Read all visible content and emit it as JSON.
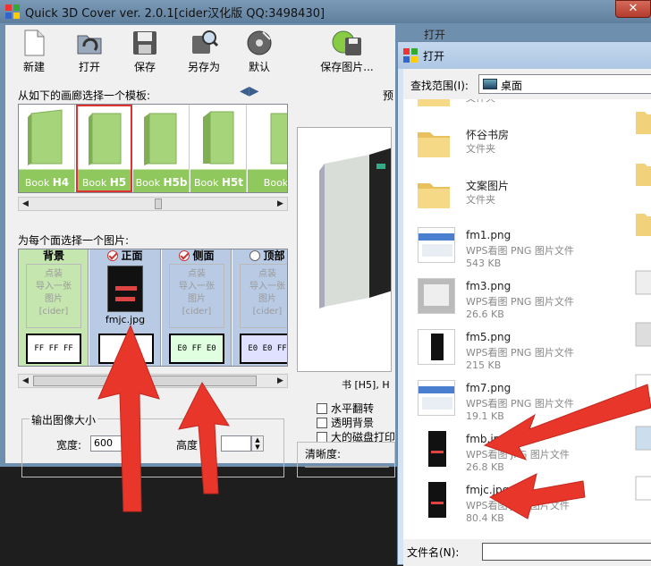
{
  "app": {
    "title": "Quick 3D Cover ver. 2.0.1[cider汉化版 QQ:3498430]",
    "close_icon": "close-icon",
    "toolbar": [
      {
        "label": "新建",
        "icon": "new-file-icon"
      },
      {
        "label": "打开",
        "icon": "open-folder-icon"
      },
      {
        "label": "保存",
        "icon": "floppy-save-icon"
      },
      {
        "label": "另存为",
        "icon": "save-as-icon"
      },
      {
        "label": "默认",
        "icon": "default-disc-icon"
      },
      {
        "label": "保存图片...",
        "icon": "save-image-icon"
      }
    ],
    "template_section_label": "从如下的画廊选择一个模板:",
    "templates": [
      {
        "prefix": "Book ",
        "code": "H4"
      },
      {
        "prefix": "Book ",
        "code": "H5"
      },
      {
        "prefix": "Book ",
        "code": "H5b"
      },
      {
        "prefix": "Book ",
        "code": "H5t"
      },
      {
        "prefix": "Book",
        "code": ""
      }
    ],
    "face_section_label": "为每个面选择一个图片:",
    "faces": [
      {
        "name": "背景",
        "placeholder": [
          "点装",
          "导入一张",
          "图片",
          "[cider]"
        ],
        "color": "FF FF FF",
        "bg": "#c6e6b0"
      },
      {
        "name": "正面",
        "file": "fmjc.jpg",
        "color": "",
        "bg": "#b9cbe4"
      },
      {
        "name": "侧面",
        "placeholder": [
          "点装",
          "导入一张",
          "图片",
          "[cider]"
        ],
        "color": "E0 FF E0",
        "bg": "#b9cbe4"
      },
      {
        "name": "顶部",
        "placeholder": [
          "点装",
          "导入一张",
          "图片",
          "[cider]"
        ],
        "color": "E0 E0 FF",
        "bg": "#b9cbe4"
      }
    ],
    "output_group": "输出图像大小",
    "width_label": "宽度:",
    "width_value": "600",
    "height_label": "高度",
    "preview_label": "预",
    "preview_caption": "书 [H5], H",
    "options": [
      "水平翻转",
      "透明背景",
      "大的磁盘打印"
    ],
    "clarity_label": "清晰度:"
  },
  "background_window": {
    "toolbar_label": "打开"
  },
  "dialog": {
    "title": "打开",
    "look_in_label": "查找范围(I):",
    "look_in_value": "桌面",
    "items": [
      {
        "name": "",
        "type": "文件夹",
        "size": "",
        "kind": "folder"
      },
      {
        "name": "怀谷书房",
        "type": "文件夹",
        "size": "",
        "kind": "folder"
      },
      {
        "name": "文案图片",
        "type": "文件夹",
        "size": "",
        "kind": "folder"
      },
      {
        "name": "fm1.png",
        "type": "WPS看图 PNG 图片文件",
        "size": "543 KB",
        "kind": "web"
      },
      {
        "name": "fm3.png",
        "type": "WPS看图 PNG 图片文件",
        "size": "26.6 KB",
        "kind": "gray"
      },
      {
        "name": "fm5.png",
        "type": "WPS看图 PNG 图片文件",
        "size": "215 KB",
        "kind": "dark"
      },
      {
        "name": "fm7.png",
        "type": "WPS看图 PNG 图片文件",
        "size": "19.1 KB",
        "kind": "web"
      },
      {
        "name": "fmb.jpg",
        "type": "WPS看图 JPG 图片文件",
        "size": "26.8 KB",
        "kind": "phone"
      },
      {
        "name": "fmjc.jpg",
        "type": "WPS看图 JPG 图片文件",
        "size": "80.4 KB",
        "kind": "phone"
      }
    ],
    "filename_label": "文件名(N):",
    "filename_value": ""
  },
  "colors": {
    "arrow": "#e8362a",
    "template_green": "#8fc85c",
    "dialog_frame": "#d6e3f0"
  }
}
